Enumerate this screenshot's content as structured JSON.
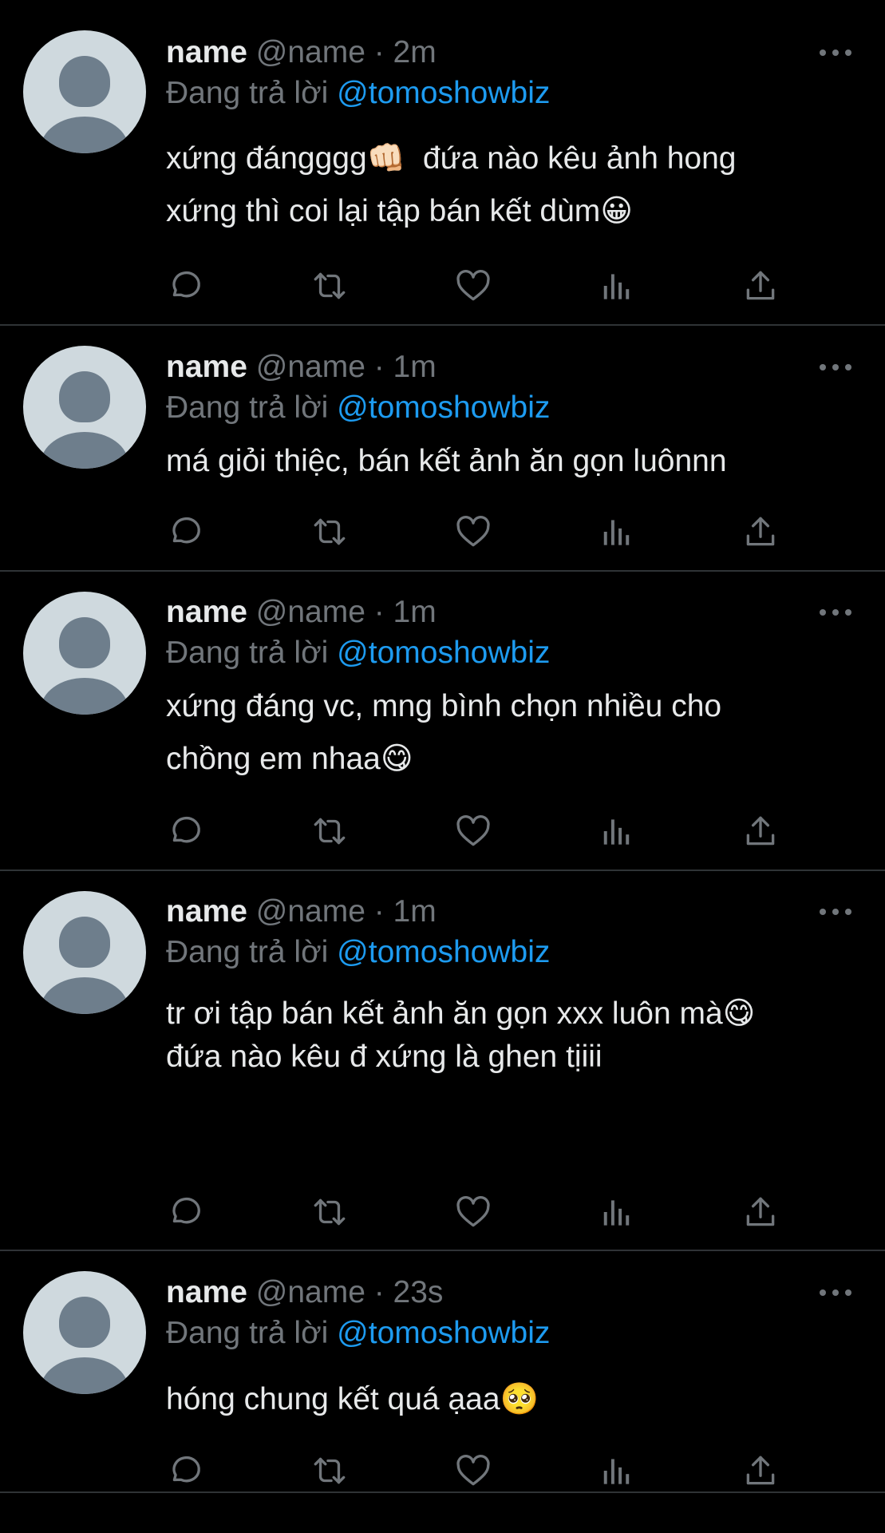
{
  "colors": {
    "background": "#000000",
    "text": "#e7e9ea",
    "muted": "#71767b",
    "mention": "#1d9bf0",
    "divider": "#2f3336",
    "avatar_bg": "#cfd9de",
    "avatar_fg": "#6e7e8c"
  },
  "tweets": [
    {
      "name": "name",
      "meta": "@name · 2m",
      "reply_prefix": "Đang trả lời ",
      "reply_to": "@tomoshowbiz",
      "text": "xứng đángggg👊🏻  đứa nào kêu ảnh hong\nxứng thì coi lại tập bán kết dùm😀"
    },
    {
      "name": "name",
      "meta": "@name · 1m",
      "reply_prefix": "Đang trả lời ",
      "reply_to": "@tomoshowbiz",
      "text": "má giỏi thiệc, bán kết ảnh ăn gọn luônnn"
    },
    {
      "name": "name",
      "meta": "@name · 1m",
      "reply_prefix": "Đang trả lời ",
      "reply_to": "@tomoshowbiz",
      "text": "xứng đáng vc, mng bình chọn nhiều cho\nchồng em nhaa😋"
    },
    {
      "name": "name",
      "meta": "@name · 1m",
      "reply_prefix": "Đang trả lời ",
      "reply_to": "@tomoshowbiz",
      "text": "tr ơi tập bán kết ảnh ăn gọn xxx luôn mà😋\nđứa nào kêu đ xứng là ghen tịiii"
    },
    {
      "name": "name",
      "meta": "@name · 23s",
      "reply_prefix": "Đang trả lời ",
      "reply_to": "@tomoshowbiz",
      "text": "hóng chung kết quá ạaa🥺"
    }
  ],
  "action_icons": [
    "reply-icon",
    "retweet-icon",
    "like-icon",
    "views-icon",
    "share-icon"
  ]
}
